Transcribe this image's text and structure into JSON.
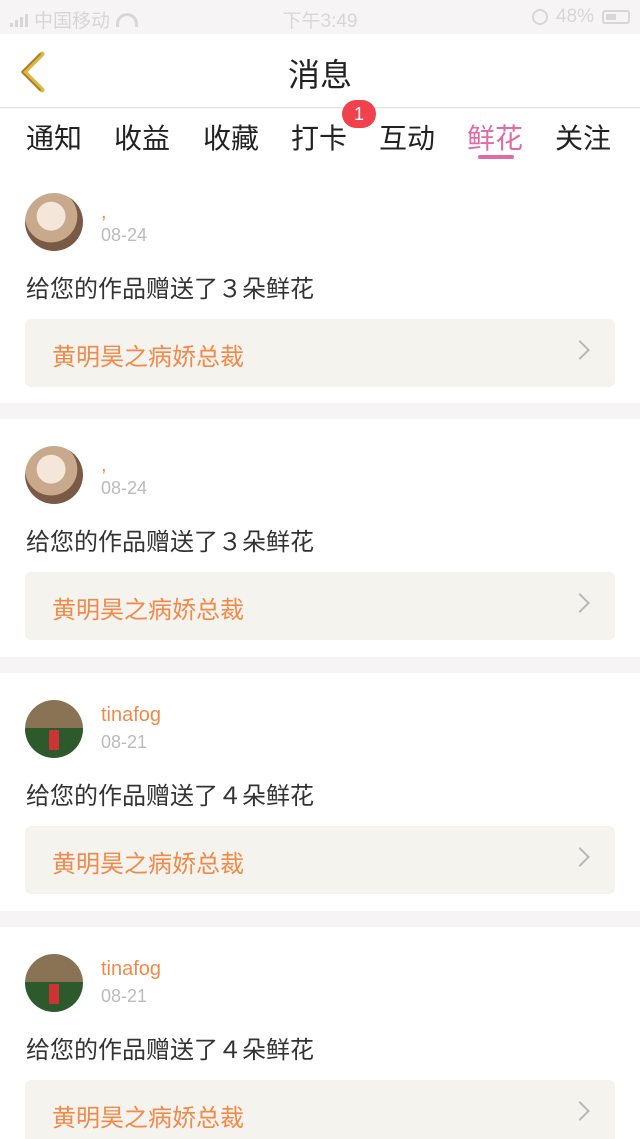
{
  "status_bar": {
    "carrier": "中国移动",
    "time": "下午3:49",
    "battery": "48%"
  },
  "nav": {
    "title": "消息",
    "back_icon": "chevron-left-icon"
  },
  "tabs": [
    {
      "label": "通知"
    },
    {
      "label": "收益"
    },
    {
      "label": "收藏"
    },
    {
      "label": "打卡",
      "badge": "1"
    },
    {
      "label": "互动"
    },
    {
      "label": "鲜花",
      "active": true
    },
    {
      "label": "关注"
    }
  ],
  "colors": {
    "accent": "#e06aa3",
    "name_orange": "#f08a4b",
    "badge_red": "#f0414d"
  },
  "messages": [
    {
      "name": ",",
      "date": "08-24",
      "text": "给您的作品赠送了３朵鲜花",
      "work": "黄明昊之病娇总裁"
    },
    {
      "name": ",",
      "date": "08-24",
      "text": "给您的作品赠送了３朵鲜花",
      "work": "黄明昊之病娇总裁"
    },
    {
      "name": "tinafog",
      "date": "08-21",
      "text": "给您的作品赠送了４朵鲜花",
      "work": "黄明昊之病娇总裁"
    },
    {
      "name": "tinafog",
      "date": "08-21",
      "text": "给您的作品赠送了４朵鲜花",
      "work": "黄明昊之病娇总裁"
    }
  ]
}
